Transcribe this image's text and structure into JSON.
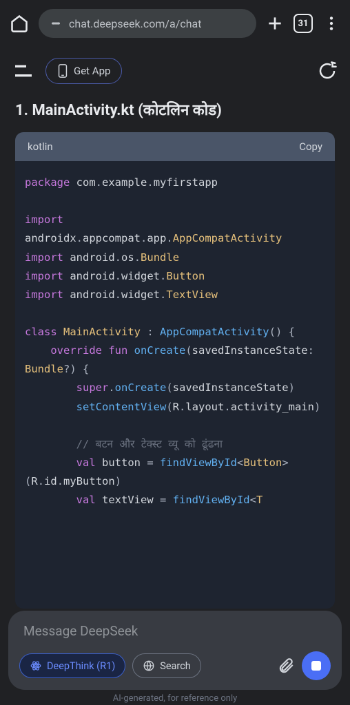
{
  "browser": {
    "url": "chat.deepseek.com/a/chat",
    "tab_count": "31"
  },
  "header": {
    "get_app": "Get App"
  },
  "heading": "1. MainActivity.kt (कोटलिन कोड)",
  "code": {
    "lang": "kotlin",
    "copy": "Copy",
    "tokens": [
      {
        "t": "kw",
        "v": "package"
      },
      {
        "t": "pun",
        "v": " "
      },
      {
        "t": "id",
        "v": "com"
      },
      {
        "t": "pun",
        "v": "."
      },
      {
        "t": "id",
        "v": "example"
      },
      {
        "t": "pun",
        "v": "."
      },
      {
        "t": "id",
        "v": "myfirstapp"
      },
      {
        "t": "br"
      },
      {
        "t": "br"
      },
      {
        "t": "kw",
        "v": "import"
      },
      {
        "t": "pun",
        "v": " "
      },
      {
        "t": "id",
        "v": "androidx"
      },
      {
        "t": "pun",
        "v": "."
      },
      {
        "t": "id",
        "v": "appcompat"
      },
      {
        "t": "pun",
        "v": "."
      },
      {
        "t": "id",
        "v": "app"
      },
      {
        "t": "pun",
        "v": "."
      },
      {
        "t": "cls",
        "v": "AppCompatActivity"
      },
      {
        "t": "br"
      },
      {
        "t": "kw",
        "v": "import"
      },
      {
        "t": "pun",
        "v": " "
      },
      {
        "t": "id",
        "v": "android"
      },
      {
        "t": "pun",
        "v": "."
      },
      {
        "t": "id",
        "v": "os"
      },
      {
        "t": "pun",
        "v": "."
      },
      {
        "t": "cls",
        "v": "Bundle"
      },
      {
        "t": "br"
      },
      {
        "t": "kw",
        "v": "import"
      },
      {
        "t": "pun",
        "v": " "
      },
      {
        "t": "id",
        "v": "android"
      },
      {
        "t": "pun",
        "v": "."
      },
      {
        "t": "id",
        "v": "widget"
      },
      {
        "t": "pun",
        "v": "."
      },
      {
        "t": "cls",
        "v": "Button"
      },
      {
        "t": "br"
      },
      {
        "t": "kw",
        "v": "import"
      },
      {
        "t": "pun",
        "v": " "
      },
      {
        "t": "id",
        "v": "android"
      },
      {
        "t": "pun",
        "v": "."
      },
      {
        "t": "id",
        "v": "widget"
      },
      {
        "t": "pun",
        "v": "."
      },
      {
        "t": "cls",
        "v": "TextView"
      },
      {
        "t": "br"
      },
      {
        "t": "br"
      },
      {
        "t": "kw",
        "v": "class"
      },
      {
        "t": "pun",
        "v": " "
      },
      {
        "t": "cls",
        "v": "MainActivity"
      },
      {
        "t": "pun",
        "v": " : "
      },
      {
        "t": "fn",
        "v": "AppCompatActivity"
      },
      {
        "t": "pun",
        "v": "() {"
      },
      {
        "t": "br"
      },
      {
        "t": "pun",
        "v": "    "
      },
      {
        "t": "kw",
        "v": "override"
      },
      {
        "t": "pun",
        "v": " "
      },
      {
        "t": "kw",
        "v": "fun"
      },
      {
        "t": "pun",
        "v": " "
      },
      {
        "t": "fn",
        "v": "onCreate"
      },
      {
        "t": "pun",
        "v": "("
      },
      {
        "t": "id",
        "v": "savedInstanceState"
      },
      {
        "t": "pun",
        "v": ": "
      },
      {
        "t": "cls",
        "v": "Bundle"
      },
      {
        "t": "pun",
        "v": "?) {"
      },
      {
        "t": "br"
      },
      {
        "t": "pun",
        "v": "        "
      },
      {
        "t": "kw",
        "v": "super"
      },
      {
        "t": "pun",
        "v": "."
      },
      {
        "t": "fn",
        "v": "onCreate"
      },
      {
        "t": "pun",
        "v": "("
      },
      {
        "t": "id",
        "v": "savedInstanceState"
      },
      {
        "t": "pun",
        "v": ")"
      },
      {
        "t": "br"
      },
      {
        "t": "pun",
        "v": "        "
      },
      {
        "t": "fn",
        "v": "setContentView"
      },
      {
        "t": "pun",
        "v": "("
      },
      {
        "t": "id",
        "v": "R"
      },
      {
        "t": "pun",
        "v": "."
      },
      {
        "t": "id",
        "v": "layout"
      },
      {
        "t": "pun",
        "v": "."
      },
      {
        "t": "id",
        "v": "activity_main"
      },
      {
        "t": "pun",
        "v": ")"
      },
      {
        "t": "br"
      },
      {
        "t": "br"
      },
      {
        "t": "pun",
        "v": "        "
      },
      {
        "t": "cmt",
        "v": "// बटन और टेक्स्ट व्यू को ढूंढना"
      },
      {
        "t": "br"
      },
      {
        "t": "pun",
        "v": "        "
      },
      {
        "t": "kw",
        "v": "val"
      },
      {
        "t": "pun",
        "v": " "
      },
      {
        "t": "id",
        "v": "button"
      },
      {
        "t": "pun",
        "v": " = "
      },
      {
        "t": "fn",
        "v": "findViewById"
      },
      {
        "t": "pun",
        "v": "<"
      },
      {
        "t": "cls",
        "v": "Button"
      },
      {
        "t": "pun",
        "v": ">("
      },
      {
        "t": "id",
        "v": "R"
      },
      {
        "t": "pun",
        "v": "."
      },
      {
        "t": "id",
        "v": "id"
      },
      {
        "t": "pun",
        "v": "."
      },
      {
        "t": "id",
        "v": "myButton"
      },
      {
        "t": "pun",
        "v": ")"
      },
      {
        "t": "br"
      },
      {
        "t": "pun",
        "v": "        "
      },
      {
        "t": "kw",
        "v": "val"
      },
      {
        "t": "pun",
        "v": " "
      },
      {
        "t": "id",
        "v": "textView"
      },
      {
        "t": "pun",
        "v": " = "
      },
      {
        "t": "fn",
        "v": "findViewById"
      },
      {
        "t": "pun",
        "v": "<"
      },
      {
        "t": "cls",
        "v": "T"
      }
    ]
  },
  "input": {
    "placeholder": "Message DeepSeek",
    "deepthink": "DeepThink (R1)",
    "search": "Search"
  },
  "footer": "AI-generated, for reference only"
}
